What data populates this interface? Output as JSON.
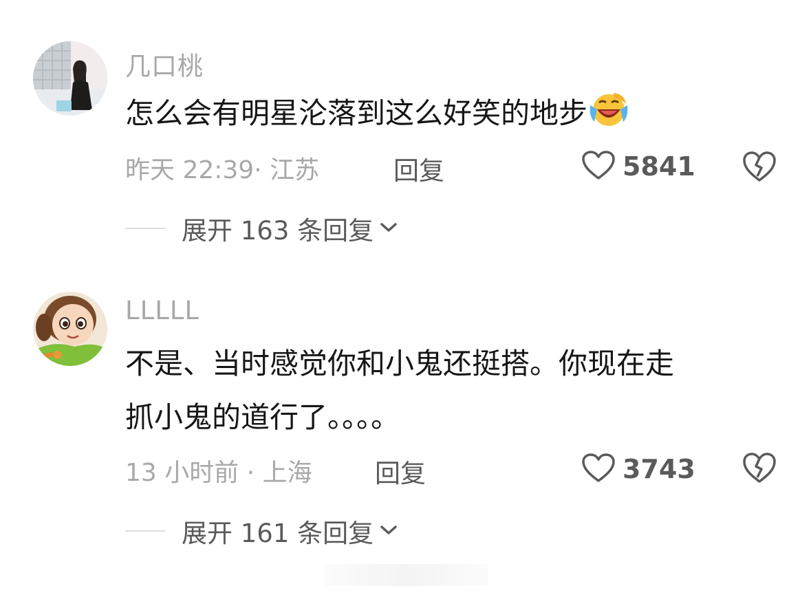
{
  "comments": [
    {
      "username": "几口桃",
      "text": "怎么会有明星沦落到这么好笑的地步",
      "emoji_icon": "laughing-crying-face-icon",
      "time_location": "昨天 22:39· 江苏",
      "reply_label": "回复",
      "likes": "5841",
      "expand_label": "展开 163 条回复"
    },
    {
      "username": "LLLLL",
      "text_line1": "不是、当时感觉你和小鬼还挺搭。你现在走",
      "text_line2": "抓小鬼的道行了。。。。",
      "time_location": "13 小时前 · 上海",
      "reply_label": "回复",
      "likes": "3743",
      "expand_label": "展开 161 条回复"
    }
  ],
  "colors": {
    "text": "#161616",
    "muted": "#a8a8a8",
    "secondary": "#5a5a5a"
  }
}
